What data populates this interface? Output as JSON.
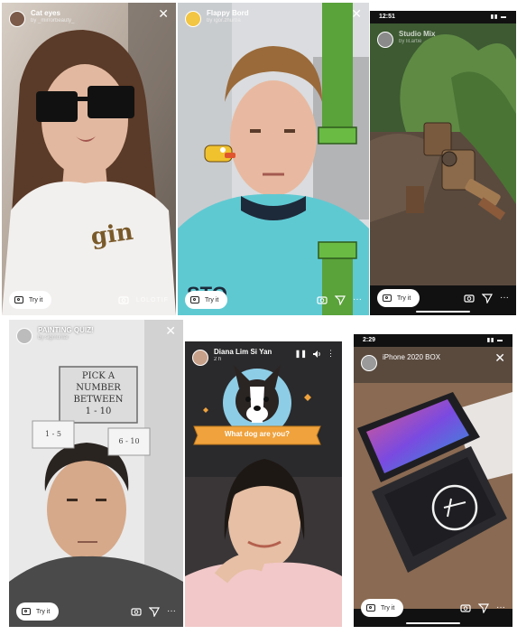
{
  "panels": {
    "cat_eyes": {
      "title": "Cat eyes",
      "author": "by _mirrorbeauty_",
      "try_label": "Try it",
      "watermark": "LOLOTIF"
    },
    "flappy": {
      "title": "Flappy Bord",
      "author": "by igor.zhurba",
      "try_label": "Try it"
    },
    "robot": {
      "time": "12:51",
      "title": "Studio Mix",
      "author": "by lil.artie",
      "try_label": "Try it"
    },
    "quiz": {
      "title": "PAINTING QUIZ!",
      "author": "by sigmunlar",
      "sign_line1": "PICK A NUMBER",
      "sign_line2": "BETWEEN",
      "sign_line3": "1 - 10",
      "card_left": "1 - 5",
      "card_right": "6 - 10",
      "try_label": "Try it"
    },
    "dog": {
      "title": "Diana Lim Si Yan",
      "author": "2 h",
      "banner": "What dog are you?"
    },
    "iphone": {
      "time": "2:29",
      "title": "iPhone 2020 BOX",
      "try_label": "Try it"
    }
  }
}
